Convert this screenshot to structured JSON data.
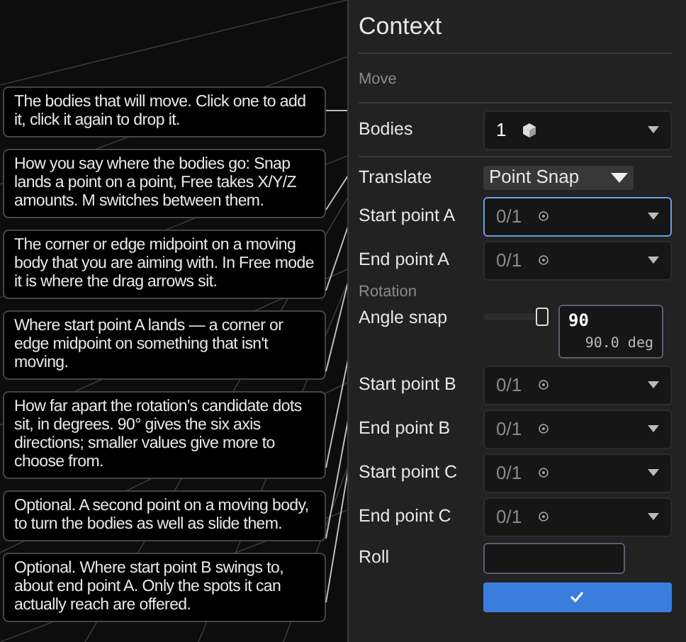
{
  "tooltips": [
    "The bodies that will move. Click one to add it, click it again to drop it.",
    "How you say where the bodies go: Snap lands a point on a point, Free takes X/Y/Z amounts. M switches between them.",
    "The corner or edge midpoint on a moving body that you are aiming with. In Free mode it is where the drag arrows sit.",
    "Where start point A lands — a corner or edge midpoint on something that isn't moving.",
    "How far apart the rotation's candidate dots sit, in degrees. 90° gives the six axis directions; smaller values give more to choose from.",
    "Optional. A second point on a moving body, to turn the bodies as well as slide them.",
    "Optional. Where start point B swings to, about end point A. Only the spots it can actually reach are offered."
  ],
  "panel": {
    "title": "Context",
    "rows": [
      {
        "kind": "heading",
        "label": "Move"
      },
      {
        "kind": "bodies",
        "label": "Bodies",
        "value": "1",
        "focused": false
      },
      {
        "kind": "mode",
        "label": "Translate",
        "value": "Point Snap"
      },
      {
        "kind": "point",
        "label": "Start point A",
        "value": "0/1",
        "focused": true
      },
      {
        "kind": "point",
        "label": "End point A",
        "value": "0/1",
        "focused": false
      },
      {
        "kind": "subheading",
        "label": "Rotation"
      },
      {
        "kind": "slider",
        "label": "Angle snap",
        "level": 1,
        "value": "90",
        "reading": "90.0 deg"
      },
      {
        "kind": "point",
        "label": "Start point B",
        "value": "0/1",
        "focused": false
      },
      {
        "kind": "point",
        "label": "End point B",
        "value": "0/1",
        "focused": false
      },
      {
        "kind": "point",
        "label": "Start point C",
        "value": "0/1",
        "focused": false
      },
      {
        "kind": "point",
        "label": "End point C",
        "value": "0/1",
        "focused": false
      },
      {
        "kind": "input",
        "label": "Roll"
      },
      {
        "kind": "confirm"
      }
    ]
  }
}
